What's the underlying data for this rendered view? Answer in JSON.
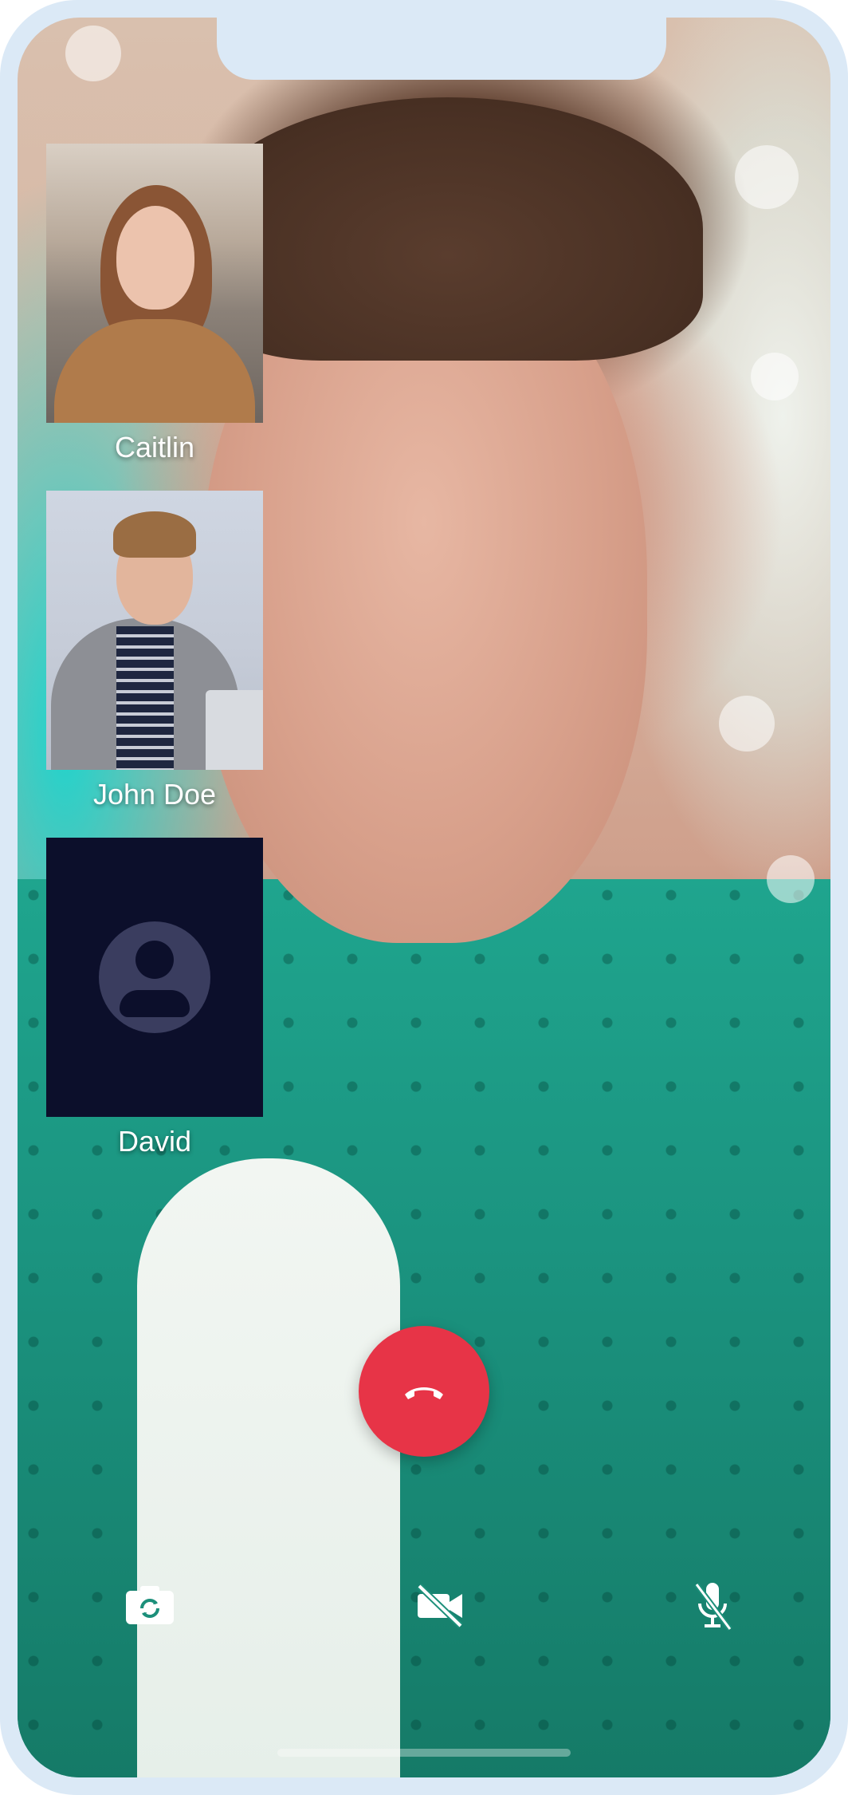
{
  "participants": [
    {
      "name": "Caitlin",
      "video": true
    },
    {
      "name": "John Doe",
      "video": true
    },
    {
      "name": "David",
      "video": false
    }
  ],
  "controls": {
    "end_call": "end-call",
    "switch_camera": "switch-camera",
    "video_off": "video-off",
    "mic_off": "mic-off"
  },
  "colors": {
    "end_call": "#e73447",
    "avatar_tile_bg": "#0c0f2b",
    "avatar_circle": "#3a3d5f",
    "frame": "#dbe9f6"
  }
}
